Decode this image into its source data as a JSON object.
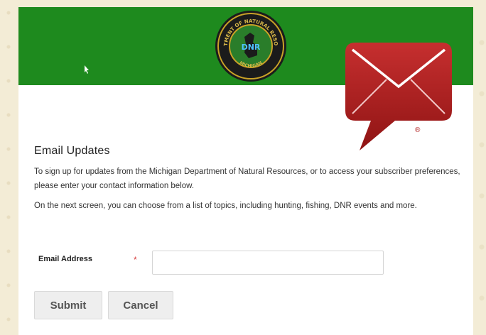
{
  "header": {
    "seal": {
      "ring_text_top": "DEPARTMENT OF NATURAL RESOURCES",
      "ring_text_bottom": "MICHIGAN",
      "center_text": "DNR"
    },
    "icons": [
      "cursor-icon",
      "mail-badge-icon"
    ],
    "registered_mark": "®"
  },
  "main": {
    "heading": "Email Updates",
    "paragraph_1": "To sign up for updates from the Michigan Department of Natural Resources, or to access your subscriber preferences, please enter your contact information below.",
    "paragraph_2": "On the next screen, you can choose from a list of topics, including hunting, fishing, DNR events and more."
  },
  "form": {
    "email_label": "Email Address",
    "required_marker": "*",
    "email_value": "",
    "email_placeholder": ""
  },
  "buttons": {
    "submit_label": "Submit",
    "cancel_label": "Cancel"
  },
  "colors": {
    "banner_green": "#1e8a1e",
    "seal_ring": "#1b1b1b",
    "seal_gold": "#c9a227",
    "mail_red": "#a82020",
    "required_red": "#d63a3a"
  }
}
